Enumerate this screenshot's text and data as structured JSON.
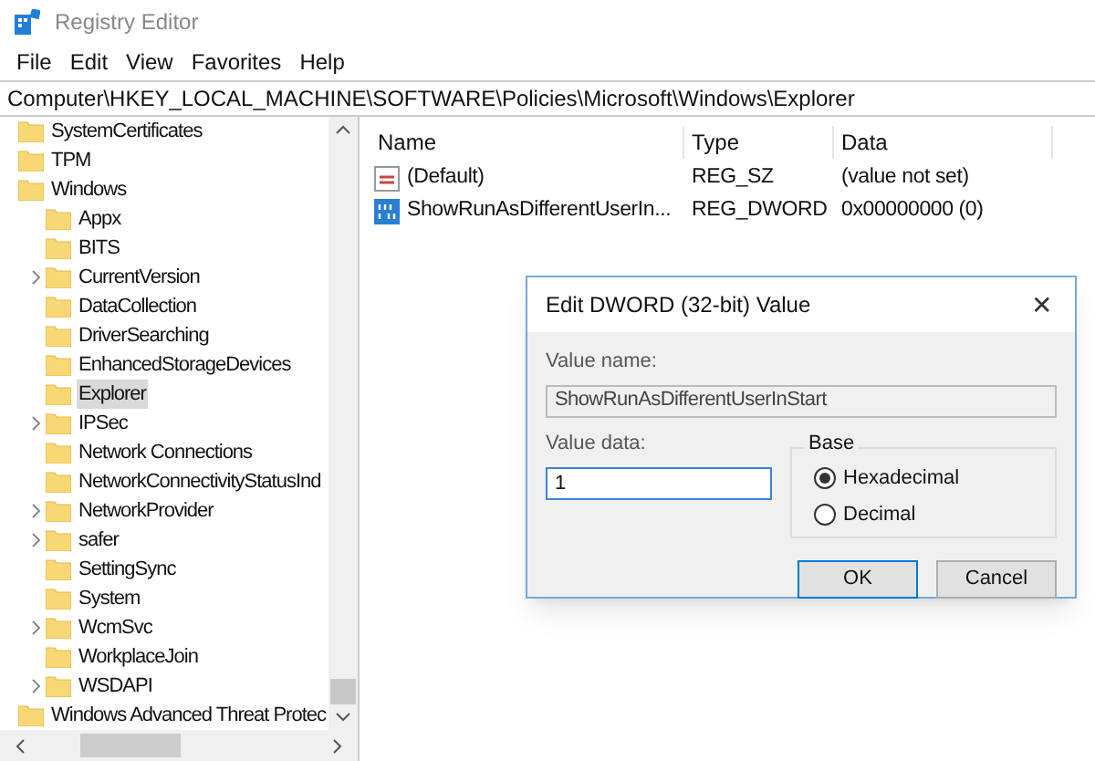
{
  "window": {
    "title": "Registry Editor"
  },
  "menu": [
    "File",
    "Edit",
    "View",
    "Favorites",
    "Help"
  ],
  "address": "Computer\\HKEY_LOCAL_MACHINE\\SOFTWARE\\Policies\\Microsoft\\Windows\\Explorer",
  "tree": [
    {
      "label": "SystemCertificates",
      "selected": false,
      "has_children": false
    },
    {
      "label": "TPM",
      "selected": false,
      "has_children": false
    },
    {
      "label": "Windows",
      "selected": false,
      "children": [
        {
          "label": "Appx",
          "selected": false,
          "has_children": false
        },
        {
          "label": "BITS",
          "selected": false,
          "has_children": false
        },
        {
          "label": "CurrentVersion",
          "selected": false,
          "has_children": true
        },
        {
          "label": "DataCollection",
          "selected": false,
          "has_children": false
        },
        {
          "label": "DriverSearching",
          "selected": false,
          "has_children": false
        },
        {
          "label": "EnhancedStorageDevices",
          "selected": false,
          "has_children": false
        },
        {
          "label": "Explorer",
          "selected": true,
          "has_children": false
        },
        {
          "label": "IPSec",
          "selected": false,
          "has_children": true
        },
        {
          "label": "Network Connections",
          "selected": false,
          "has_children": false
        },
        {
          "label": "NetworkConnectivityStatusInd",
          "selected": false,
          "has_children": false
        },
        {
          "label": "NetworkProvider",
          "selected": false,
          "has_children": true
        },
        {
          "label": "safer",
          "selected": false,
          "has_children": true
        },
        {
          "label": "SettingSync",
          "selected": false,
          "has_children": false
        },
        {
          "label": "System",
          "selected": false,
          "has_children": false
        },
        {
          "label": "WcmSvc",
          "selected": false,
          "has_children": true
        },
        {
          "label": "WorkplaceJoin",
          "selected": false,
          "has_children": false
        },
        {
          "label": "WSDAPI",
          "selected": false,
          "has_children": true
        }
      ]
    },
    {
      "label": "Windows Advanced Threat Protec",
      "selected": false,
      "has_children": false
    }
  ],
  "table": {
    "columns": [
      "Name",
      "Type",
      "Data"
    ],
    "rows": [
      {
        "kind": "string",
        "name": "(Default)",
        "type": "REG_SZ",
        "data": "(value not set)"
      },
      {
        "kind": "binary",
        "name": "ShowRunAsDifferentUserIn...",
        "type": "REG_DWORD",
        "data": "0x00000000 (0)"
      }
    ]
  },
  "dialog": {
    "title": "Edit DWORD (32-bit) Value",
    "close": "✕",
    "value_name_label": "Value name:",
    "value_name": "ShowRunAsDifferentUserInStart",
    "value_data_label": "Value data:",
    "value_data": "1",
    "base_label": "Base",
    "base_options": [
      {
        "label": "Hexadecimal",
        "selected": true
      },
      {
        "label": "Decimal",
        "selected": false
      }
    ],
    "buttons": [
      {
        "label": "OK",
        "default": true
      },
      {
        "label": "Cancel",
        "default": false
      }
    ]
  }
}
